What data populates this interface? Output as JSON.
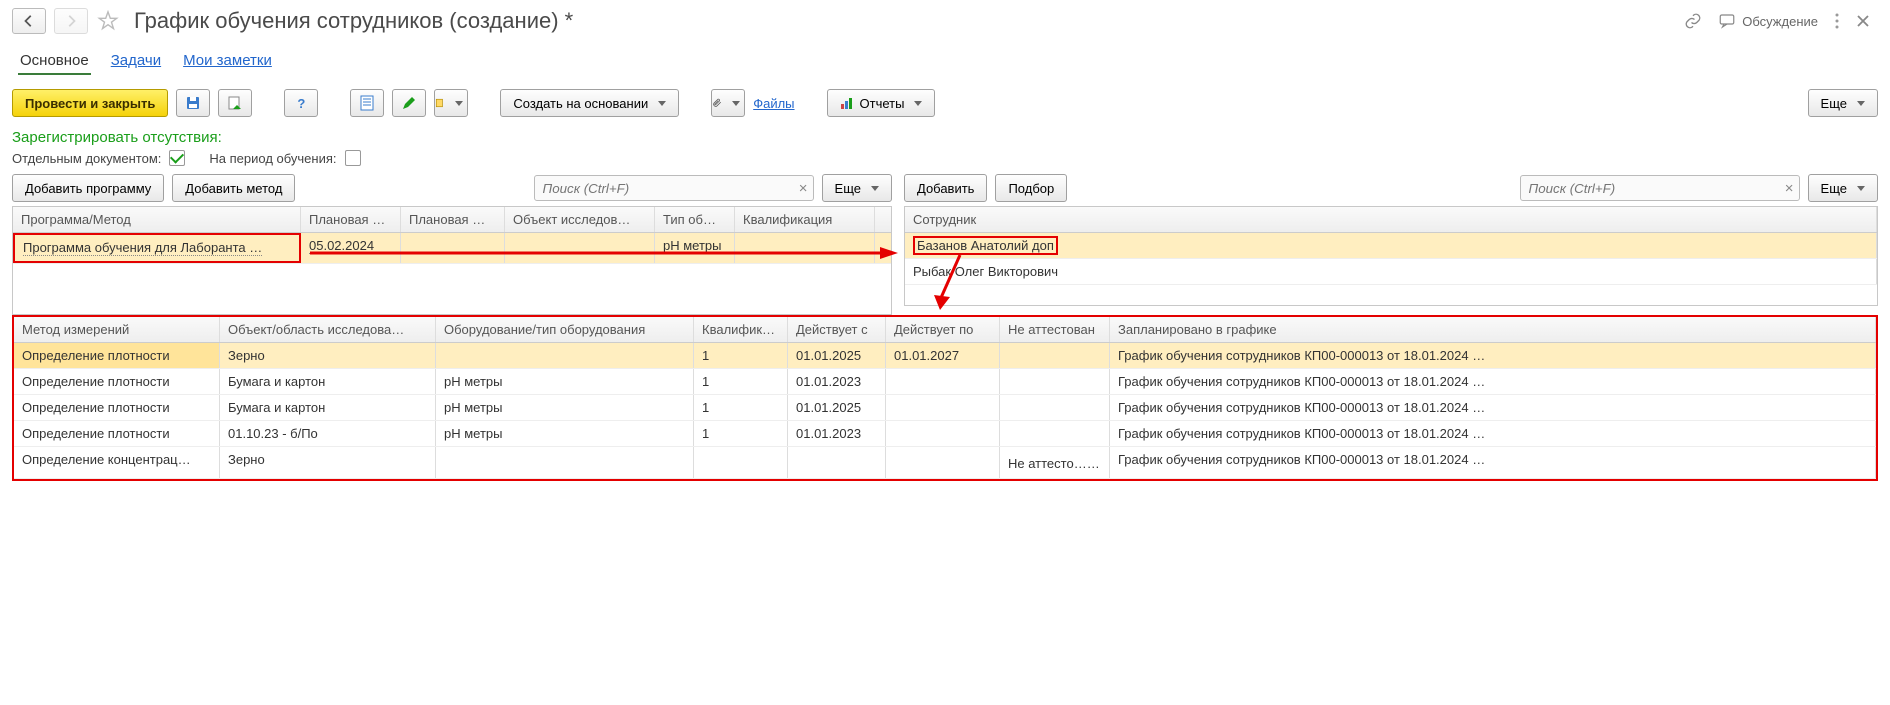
{
  "header": {
    "title": "График обучения сотрудников (создание) *",
    "discussion": "Обсуждение"
  },
  "tabs": {
    "main": "Основное",
    "tasks": "Задачи",
    "notes": "Мои заметки"
  },
  "toolbar": {
    "save_close": "Провести и закрыть",
    "create_based": "Создать на основании",
    "files": "Файлы",
    "reports": "Отчеты",
    "more": "Еще"
  },
  "register": {
    "title": "Зарегистрировать отсутствия:",
    "separate_doc": "Отдельным документом:",
    "period": "На период обучения:"
  },
  "left_panel": {
    "add_program": "Добавить программу",
    "add_method": "Добавить метод",
    "search_ph": "Поиск (Ctrl+F)",
    "more": "Еще",
    "headers": {
      "program": "Программа/Метод",
      "plan1": "Плановая …",
      "plan2": "Плановая …",
      "object": "Объект исследов…",
      "type": "Тип об…",
      "qual": "Квалификация"
    },
    "rows": [
      {
        "program": "Программа обучения для Лаборанта …",
        "plan1": "05.02.2024",
        "plan2": "",
        "object": "",
        "type": "pH метры",
        "qual": ""
      }
    ]
  },
  "right_panel": {
    "add": "Добавить",
    "select": "Подбор",
    "search_ph": "Поиск (Ctrl+F)",
    "more": "Еще",
    "headers": {
      "employee": "Сотрудник"
    },
    "rows": [
      {
        "name": "Базанов Анатолий доп"
      },
      {
        "name": "Рыбак Олег Викторович"
      }
    ]
  },
  "bottom": {
    "headers": {
      "method": "Метод измерений",
      "object": "Объект/область исследова…",
      "equip": "Оборудование/тип оборудования",
      "qual": "Квалифик…",
      "from": "Действует с",
      "to": "Действует по",
      "not_cert": "Не аттестован",
      "planned": "Запланировано в графике"
    },
    "rows": [
      {
        "method": "Определение плотности",
        "object": "Зерно",
        "equip": "",
        "qual": "1",
        "from": "01.01.2025",
        "to": "01.01.2027",
        "not_cert": "",
        "check": false,
        "planned": "График обучения сотрудников КП00-000013 от 18.01.2024 …"
      },
      {
        "method": "Определение плотности",
        "object": "Бумага и картон",
        "equip": "pH метры",
        "qual": "1",
        "from": "01.01.2023",
        "to": "",
        "not_cert": "",
        "check": false,
        "planned": "График обучения сотрудников КП00-000013 от 18.01.2024 …"
      },
      {
        "method": "Определение плотности",
        "object": "Бумага и картон",
        "equip": "pH метры",
        "qual": "1",
        "from": "01.01.2025",
        "to": "",
        "not_cert": "",
        "check": false,
        "planned": "График обучения сотрудников КП00-000013 от 18.01.2024 …"
      },
      {
        "method": "Определение плотности",
        "object": "01.10.23 - б/По",
        "equip": "pH метры",
        "qual": "1",
        "from": "01.01.2023",
        "to": "",
        "not_cert": "",
        "check": false,
        "planned": "График обучения сотрудников КП00-000013 от 18.01.2024 …"
      },
      {
        "method": "Определение концентрац…",
        "object": "Зерно",
        "equip": "",
        "qual": "",
        "from": "",
        "to": "",
        "not_cert": "Не аттесто…",
        "check": true,
        "planned": "График обучения сотрудников КП00-000013 от 18.01.2024 …"
      }
    ]
  }
}
